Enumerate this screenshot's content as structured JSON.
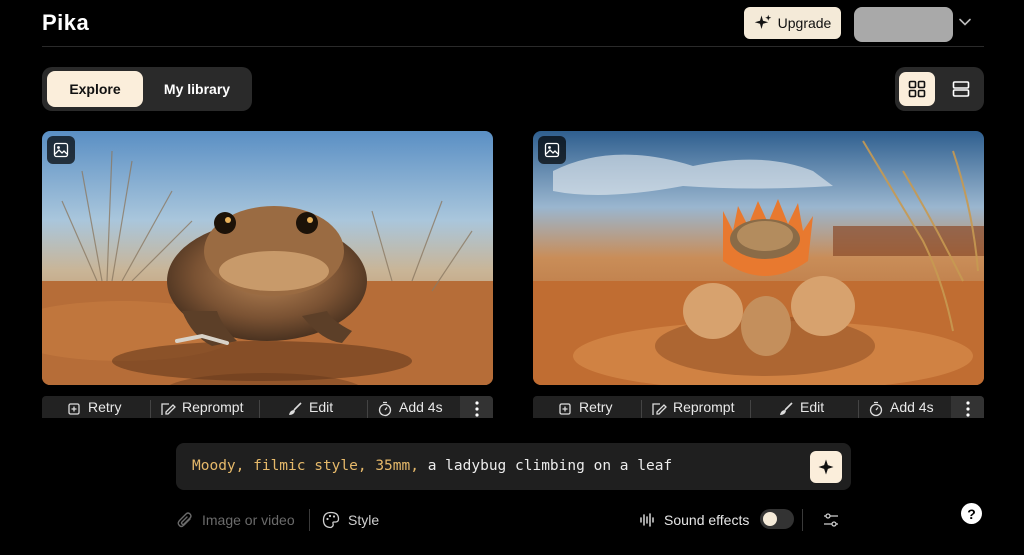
{
  "app": {
    "name": "Pika"
  },
  "header": {
    "upgrade_label": "Upgrade",
    "icons": {
      "upgrade": "sparkle-icon",
      "account_menu": "chevron-down-icon"
    }
  },
  "tabs": [
    {
      "label": "Explore",
      "active": true
    },
    {
      "label": "My library",
      "active": false
    }
  ],
  "view_toggle": {
    "selected": "grid",
    "icons": [
      "grid-view-icon",
      "list-view-icon"
    ]
  },
  "cards": [
    {
      "subject": "toad",
      "badge_icon": "image-icon",
      "actions": [
        {
          "label": "Retry",
          "icon": "retry-icon"
        },
        {
          "label": "Reprompt",
          "icon": "edit-prompt-icon"
        },
        {
          "label": "Edit",
          "icon": "brush-icon"
        },
        {
          "label": "Add 4s",
          "icon": "timer-icon"
        }
      ],
      "more_icon": "more-vertical-icon"
    },
    {
      "subject": "cactus",
      "badge_icon": "image-icon",
      "actions": [
        {
          "label": "Retry",
          "icon": "retry-icon"
        },
        {
          "label": "Reprompt",
          "icon": "edit-prompt-icon"
        },
        {
          "label": "Edit",
          "icon": "brush-icon"
        },
        {
          "label": "Add 4s",
          "icon": "timer-icon"
        }
      ],
      "more_icon": "more-vertical-icon"
    }
  ],
  "prompt": {
    "style_prefix": "Moody, filmic style, 35mm,",
    "text": "a ladybug climbing on a leaf",
    "generate_icon": "sparkle-icon"
  },
  "bottom_bar": {
    "attach_placeholder": "Image or video",
    "style_label": "Style",
    "sound_effects_label": "Sound effects",
    "sound_effects_enabled": false,
    "help_label": "?"
  },
  "colors": {
    "background": "#000000",
    "accent": "#fbeedb",
    "prompt_style": "#e6b96a",
    "panel": "#2a2a2a"
  }
}
